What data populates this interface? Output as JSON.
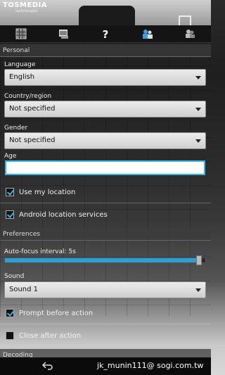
{
  "app": {
    "logo_text": "TOSMEDIA",
    "logo_sub": "technologies"
  },
  "toolbar": {
    "icons": [
      "grid-icon",
      "barcode-history-icon",
      "help-icon",
      "share-contacts-icon",
      "people-icon"
    ]
  },
  "personal": {
    "header": "Personal",
    "language": {
      "label": "Language",
      "value": "English"
    },
    "country": {
      "label": "Country/region",
      "value": "Not specified"
    },
    "gender": {
      "label": "Gender",
      "value": "Not specified"
    },
    "age": {
      "label": "Age",
      "value": "",
      "placeholder": ""
    },
    "use_location": {
      "label": "Use my location",
      "checked": true
    },
    "android_location": {
      "label": "Android location services",
      "checked": true
    }
  },
  "preferences": {
    "header": "Preferences",
    "autofocus": {
      "label": "Auto-focus interval: 5s",
      "fraction": 0.97
    },
    "sound": {
      "label": "Sound",
      "value": "Sound 1"
    },
    "prompt_before_action": {
      "label": "Prompt before action",
      "checked": true
    },
    "close_after_action": {
      "label": "Close after action",
      "checked": false
    }
  },
  "decoding": {
    "header": "Decoding"
  },
  "navbar": {
    "watermark": "jk_munin111@ sogi.com.tw"
  },
  "colors": {
    "accent": "#33b5e5",
    "slider": "#2aa0d4",
    "toolbar_bg": "#141414"
  }
}
